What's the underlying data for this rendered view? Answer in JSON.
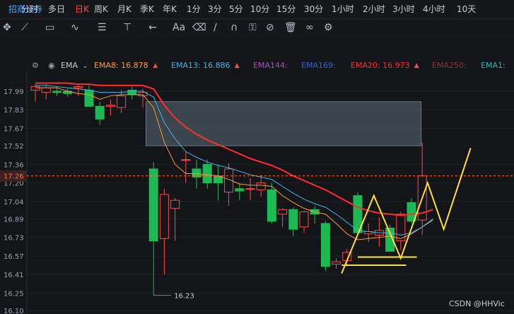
{
  "brand": "招商证券",
  "timeframes": [
    {
      "label": "分时",
      "x": 45
    },
    {
      "label": "多日",
      "x": 83
    },
    {
      "label": "日K",
      "x": 121,
      "active": true
    },
    {
      "label": "周K",
      "x": 148
    },
    {
      "label": "月K",
      "x": 181
    },
    {
      "label": "季K",
      "x": 213
    },
    {
      "label": "年K",
      "x": 245
    },
    {
      "label": "1分",
      "x": 279
    },
    {
      "label": "3分",
      "x": 309
    },
    {
      "label": "5分",
      "x": 339
    },
    {
      "label": "10分",
      "x": 369
    },
    {
      "label": "15分",
      "x": 406
    },
    {
      "label": "30分",
      "x": 445
    },
    {
      "label": "1小时",
      "x": 484
    },
    {
      "label": "2小时",
      "x": 528
    },
    {
      "label": "3小时",
      "x": 570
    },
    {
      "label": "4小时",
      "x": 613
    },
    {
      "label": "10天",
      "x": 661
    }
  ],
  "ema_bar": {
    "label": "EMA",
    "items": [
      {
        "name": "EMA8:",
        "value": "16.878",
        "color": "#ff9a2e"
      },
      {
        "name": "EMA13:",
        "value": "16.886",
        "color": "#3fb6e8"
      },
      {
        "name": "EMA144:",
        "value": "",
        "color": "#b24ac9"
      },
      {
        "name": "EMA169:",
        "value": "",
        "color": "#2f66d6"
      },
      {
        "name": "EMA20:",
        "value": "16.973",
        "color": "#ff2d2d"
      },
      {
        "name": "EMA250:",
        "value": "",
        "color": "#8b3a3a"
      },
      {
        "name": "EMA1:",
        "value": "",
        "color": "#2db7b2"
      }
    ]
  },
  "watermark": "CSDN @HHVic",
  "colors": {
    "up": "#ff4a4a",
    "down": "#1db954",
    "ema8": "#ff9a2e",
    "ema13": "#3fb6e8",
    "ema20": "#ff2d2d",
    "annot": "#ffe135",
    "box": "#4a5560"
  },
  "chart_data": {
    "type": "candlestick",
    "ylim": [
      16.1,
      18.05
    ],
    "y_ticks": [
      17.99,
      17.83,
      17.67,
      17.52,
      17.36,
      17.2,
      17.04,
      16.89,
      16.73,
      16.57,
      16.41,
      16.25,
      16.1
    ],
    "current_price": 17.26,
    "low_annotation": "16.23",
    "candles": [
      {
        "o": 18.0,
        "h": 18.05,
        "l": 17.9,
        "c": 18.03
      },
      {
        "o": 17.98,
        "h": 18.05,
        "l": 17.92,
        "c": 18.02
      },
      {
        "o": 17.99,
        "h": 18.03,
        "l": 17.95,
        "c": 17.98
      },
      {
        "o": 17.99,
        "h": 18.01,
        "l": 17.94,
        "c": 17.97
      },
      {
        "o": 18.02,
        "h": 18.05,
        "l": 17.95,
        "c": 18.03
      },
      {
        "o": 18.0,
        "h": 18.04,
        "l": 17.86,
        "c": 17.86
      },
      {
        "o": 17.86,
        "h": 17.9,
        "l": 17.7,
        "c": 17.75
      },
      {
        "o": 17.86,
        "h": 17.92,
        "l": 17.78,
        "c": 17.87
      },
      {
        "o": 17.85,
        "h": 18.0,
        "l": 17.8,
        "c": 17.95
      },
      {
        "o": 18.0,
        "h": 18.03,
        "l": 17.92,
        "c": 17.96
      },
      {
        "o": 17.95,
        "h": 18.01,
        "l": 17.85,
        "c": 17.98
      },
      {
        "o": 17.32,
        "h": 17.38,
        "l": 16.23,
        "c": 16.7
      },
      {
        "o": 16.72,
        "h": 17.15,
        "l": 16.41,
        "c": 17.1
      },
      {
        "o": 16.98,
        "h": 17.07,
        "l": 16.7,
        "c": 17.05
      },
      {
        "o": 17.4,
        "h": 17.47,
        "l": 17.2,
        "c": 17.4
      },
      {
        "o": 17.32,
        "h": 17.4,
        "l": 17.15,
        "c": 17.25
      },
      {
        "o": 17.36,
        "h": 17.4,
        "l": 17.15,
        "c": 17.2
      },
      {
        "o": 17.26,
        "h": 17.36,
        "l": 17.05,
        "c": 17.2
      },
      {
        "o": 17.12,
        "h": 17.37,
        "l": 17.0,
        "c": 17.32
      },
      {
        "o": 17.15,
        "h": 17.2,
        "l": 17.05,
        "c": 17.13
      },
      {
        "o": 17.15,
        "h": 17.24,
        "l": 17.05,
        "c": 17.15
      },
      {
        "o": 17.14,
        "h": 17.27,
        "l": 17.08,
        "c": 17.2
      },
      {
        "o": 17.14,
        "h": 17.2,
        "l": 16.85,
        "c": 16.87
      },
      {
        "o": 16.93,
        "h": 16.98,
        "l": 16.82,
        "c": 16.97
      },
      {
        "o": 16.97,
        "h": 16.99,
        "l": 16.74,
        "c": 16.8
      },
      {
        "o": 16.82,
        "h": 16.96,
        "l": 16.77,
        "c": 16.95
      },
      {
        "o": 16.97,
        "h": 17.0,
        "l": 16.85,
        "c": 16.93
      },
      {
        "o": 16.85,
        "h": 16.87,
        "l": 16.44,
        "c": 16.48
      },
      {
        "o": 16.5,
        "h": 16.55,
        "l": 16.46,
        "c": 16.52
      },
      {
        "o": 16.53,
        "h": 16.63,
        "l": 16.48,
        "c": 16.6
      },
      {
        "o": 17.09,
        "h": 17.12,
        "l": 16.75,
        "c": 16.77
      },
      {
        "o": 16.76,
        "h": 16.85,
        "l": 16.69,
        "c": 16.78
      },
      {
        "o": 16.75,
        "h": 16.9,
        "l": 16.65,
        "c": 16.79
      },
      {
        "o": 16.81,
        "h": 16.84,
        "l": 16.61,
        "c": 16.61
      },
      {
        "o": 16.7,
        "h": 16.95,
        "l": 16.62,
        "c": 16.93
      },
      {
        "o": 17.03,
        "h": 17.07,
        "l": 16.85,
        "c": 16.87
      },
      {
        "o": 16.88,
        "h": 17.55,
        "l": 16.75,
        "c": 17.26
      }
    ],
    "ema_series": [
      {
        "name": "EMA8",
        "values": [
          18.02,
          18.02,
          18.02,
          17.99,
          17.97,
          17.96,
          17.92,
          17.95,
          17.96,
          17.96,
          17.96,
          17.85,
          17.55,
          17.36,
          17.28,
          17.28,
          17.27,
          17.26,
          17.23,
          17.19,
          17.18,
          17.18,
          17.17,
          17.09,
          17.03,
          16.98,
          16.95,
          16.93,
          16.85,
          16.76,
          16.71,
          16.72,
          16.73,
          16.74,
          16.72,
          16.76,
          16.82,
          16.88
        ]
      },
      {
        "name": "EMA13",
        "values": [
          18.04,
          18.04,
          18.03,
          18.02,
          18.01,
          18.0,
          17.98,
          17.98,
          17.98,
          17.99,
          17.99,
          17.94,
          17.72,
          17.58,
          17.47,
          17.42,
          17.38,
          17.35,
          17.33,
          17.3,
          17.27,
          17.25,
          17.23,
          17.17,
          17.11,
          17.06,
          17.02,
          16.99,
          16.93,
          16.86,
          16.79,
          16.78,
          16.77,
          16.77,
          16.75,
          16.77,
          16.82,
          16.89
        ]
      },
      {
        "name": "EMA20",
        "values": [
          18.06,
          18.06,
          18.06,
          18.06,
          18.05,
          18.05,
          18.04,
          18.04,
          18.04,
          18.04,
          18.04,
          18.01,
          17.87,
          17.76,
          17.68,
          17.62,
          17.57,
          17.53,
          17.49,
          17.45,
          17.41,
          17.38,
          17.35,
          17.31,
          17.26,
          17.22,
          17.18,
          17.14,
          17.09,
          17.04,
          16.99,
          16.96,
          16.94,
          16.93,
          16.92,
          16.93,
          16.94,
          16.97
        ]
      }
    ],
    "zone_box": {
      "i0": 10.3,
      "i1": 35.9,
      "y_top": 17.9,
      "y_bot": 17.52
    },
    "annotation_lines": {
      "w_pattern": [
        [
          28.5,
          16.42
        ],
        [
          31.5,
          17.09
        ],
        [
          34.0,
          16.55
        ],
        [
          36.5,
          17.2
        ],
        [
          38.0,
          16.8
        ],
        [
          40.5,
          17.5
        ]
      ],
      "support": [
        {
          "i0": 28.5,
          "i1": 34.5,
          "y": 16.49
        },
        {
          "i0": 30.0,
          "i1": 35.5,
          "y": 16.56
        }
      ]
    }
  }
}
